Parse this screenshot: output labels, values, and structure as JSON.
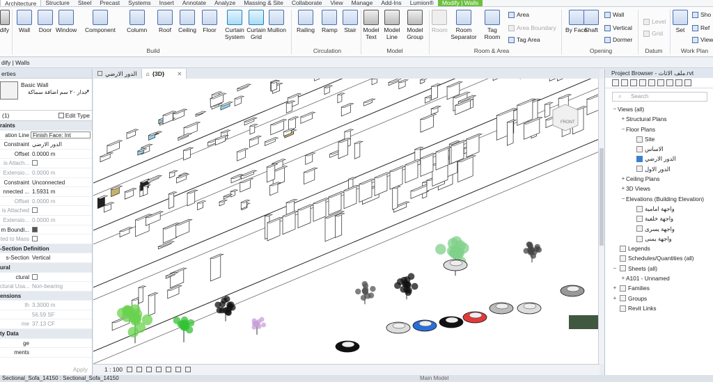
{
  "ribbon_tabs": [
    "Architecture",
    "Structure",
    "Steel",
    "Precast",
    "Systems",
    "Insert",
    "Annotate",
    "Analyze",
    "Massing & Site",
    "Collaborate",
    "View",
    "Manage",
    "Add-Ins",
    "Lumion®",
    "Modify | Walls"
  ],
  "ribbon": {
    "modify": "odify",
    "build_buttons": [
      "Wall",
      "Door",
      "Window",
      "Component",
      "Column",
      "Roof",
      "Ceiling",
      "Floor",
      "Curtain System",
      "Curtain Grid",
      "Mullion"
    ],
    "build_title": "Build",
    "circulation_buttons": [
      "Railing",
      "Ramp",
      "Stair"
    ],
    "circulation_title": "Circulation",
    "model_buttons": [
      "Model Text",
      "Model Line",
      "Model Group"
    ],
    "model_title": "Model",
    "room_buttons": [
      "Room",
      "Room Separator",
      "Tag Room"
    ],
    "room_small": [
      "Area",
      "Area Boundary",
      "Tag Area"
    ],
    "room_title": "Room & Area",
    "opening_buttons": [
      "By Face",
      "Shaft"
    ],
    "opening_small": [
      "Wall",
      "Vertical",
      "Dormer"
    ],
    "opening_title": "Opening",
    "datum_small": [
      "Level",
      "Grid"
    ],
    "datum_title": "Datum",
    "workplane_buttons": [
      "Set"
    ],
    "workplane_small": [
      "Sho",
      "Ref",
      "View"
    ],
    "workplane_title": "Work Plan"
  },
  "options_bar": "dify | Walls",
  "properties": {
    "title": "erties",
    "type_name": "Basic Wall",
    "type_sub": "جدار ٢٠ سم اضافة سماكة",
    "instance_count": "(1)",
    "edit_type": "Edit Type",
    "rows": [
      {
        "k": "raints",
        "v": "",
        "group": true
      },
      {
        "k": "ation Line",
        "v": "Finish Face: Int",
        "boxed": true
      },
      {
        "k": "Constraint",
        "v": "الدور الارضي"
      },
      {
        "k": "Offset",
        "v": "0.0000 m"
      },
      {
        "k": "is Attach...",
        "v": "",
        "grey": true,
        "check": "off"
      },
      {
        "k": "Extensio...",
        "v": "0.0000 m",
        "grey": true
      },
      {
        "k": "Constraint",
        "v": "Unconnected"
      },
      {
        "k": "nnected ...",
        "v": "1.5931 m"
      },
      {
        "k": "Offset",
        "v": "0.0000 m",
        "grey": true
      },
      {
        "k": "is Attached",
        "v": "",
        "grey": true,
        "check": "off"
      },
      {
        "k": "Extensio...",
        "v": "0.0000 m",
        "grey": true
      },
      {
        "k": "m Boundi...",
        "v": "",
        "check": "on"
      },
      {
        "k": "ted to Mass",
        "v": "",
        "grey": true,
        "check": "off"
      },
      {
        "k": "-Section Definition",
        "v": "",
        "group": true
      },
      {
        "k": "s-Section",
        "v": "Vertical"
      },
      {
        "k": "ural",
        "v": "",
        "group": true
      },
      {
        "k": "ctural",
        "v": "",
        "check": "off"
      },
      {
        "k": "ctural Usa...",
        "v": "Non-bearing",
        "grey": true
      },
      {
        "k": "ensions",
        "v": "",
        "group": true
      },
      {
        "k": "th",
        "v": "3.3000 m",
        "grey": true
      },
      {
        "k": "",
        "v": "56.59 SF",
        "grey": true
      },
      {
        "k": "me",
        "v": "37.13 CF",
        "grey": true
      },
      {
        "k": "ty Data",
        "v": "",
        "group": true
      },
      {
        "k": "ge",
        "v": ""
      },
      {
        "k": "ments",
        "v": ""
      }
    ],
    "apply": "Apply"
  },
  "view_tabs": [
    {
      "label": "الدور الارضي",
      "active": false
    },
    {
      "label": "{3D}",
      "active": true
    }
  ],
  "view_control": {
    "scale": "1 : 100"
  },
  "browser": {
    "title": "Project Browser - ملف الاثاث.rvt",
    "search_placeholder": "Search",
    "items": [
      {
        "label": "Views (all)",
        "indent": 0,
        "exp": "−"
      },
      {
        "label": "Structural Plans",
        "indent": 1,
        "exp": "+"
      },
      {
        "label": "Floor Plans",
        "indent": 1,
        "exp": "−"
      },
      {
        "label": "Site",
        "indent": 2,
        "exp": "",
        "icon": true
      },
      {
        "label": "الاساس",
        "indent": 2,
        "exp": "",
        "icon": true,
        "rtl": true
      },
      {
        "label": "الدور الارضي",
        "indent": 2,
        "exp": "",
        "icon": true,
        "sel": true,
        "rtl": true
      },
      {
        "label": "الدور الاول",
        "indent": 2,
        "exp": "",
        "icon": true,
        "rtl": true
      },
      {
        "label": "Ceiling Plans",
        "indent": 1,
        "exp": "+"
      },
      {
        "label": "3D Views",
        "indent": 1,
        "exp": "+"
      },
      {
        "label": "Elevations (Building Elevation)",
        "indent": 1,
        "exp": "−"
      },
      {
        "label": "واجهة امامية",
        "indent": 2,
        "exp": "",
        "icon": true,
        "rtl": true
      },
      {
        "label": "واجهة خلفية",
        "indent": 2,
        "exp": "",
        "icon": true,
        "rtl": true
      },
      {
        "label": "واجهة يسرى",
        "indent": 2,
        "exp": "",
        "icon": true,
        "rtl": true
      },
      {
        "label": "واجهة يمنى",
        "indent": 2,
        "exp": "",
        "icon": true,
        "rtl": true
      },
      {
        "label": "Legends",
        "indent": 0,
        "exp": "",
        "icon": true
      },
      {
        "label": "Schedules/Quantities (all)",
        "indent": 0,
        "exp": "",
        "icon": true
      },
      {
        "label": "Sheets (all)",
        "indent": 0,
        "exp": "−",
        "icon": true
      },
      {
        "label": "A101 - Unnamed",
        "indent": 1,
        "exp": "+"
      },
      {
        "label": "Families",
        "indent": 0,
        "exp": "+",
        "icon": true
      },
      {
        "label": "Groups",
        "indent": 0,
        "exp": "+",
        "icon": true
      },
      {
        "label": "Revit Links",
        "indent": 0,
        "exp": "",
        "icon": true
      }
    ]
  },
  "status": {
    "text": "Sectional_Sofa_14150 : Sectional_Sofa_14150",
    "model": "Main Model"
  },
  "viewcube_label": "FRONT"
}
